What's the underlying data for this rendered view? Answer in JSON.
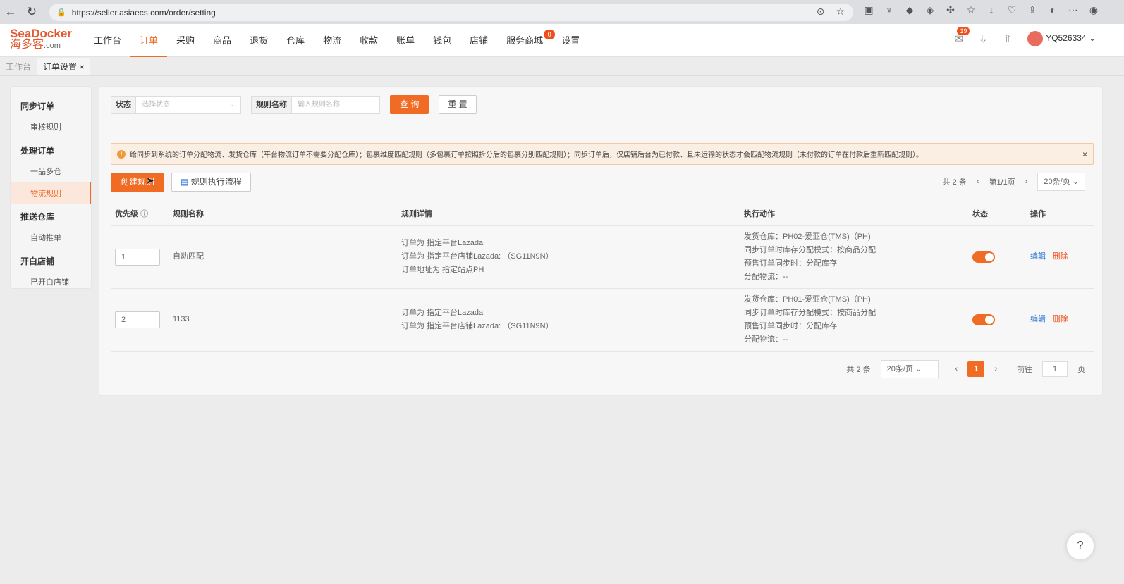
{
  "browser": {
    "url": "https://seller.asiaecs.com/order/setting"
  },
  "logo": {
    "line1": "SeaDocker",
    "line2": "海多客",
    "suffix": ".com"
  },
  "nav": {
    "items": [
      {
        "label": "工作台"
      },
      {
        "label": "订单",
        "active": true
      },
      {
        "label": "采购"
      },
      {
        "label": "商品"
      },
      {
        "label": "退货"
      },
      {
        "label": "仓库"
      },
      {
        "label": "物流"
      },
      {
        "label": "收款"
      },
      {
        "label": "账单"
      },
      {
        "label": "钱包"
      },
      {
        "label": "店铺"
      },
      {
        "label": "服务商城",
        "badge": "0"
      },
      {
        "label": "设置"
      }
    ],
    "notification_count": "19",
    "username": "YQ526334"
  },
  "tabs": [
    {
      "label": "工作台"
    },
    {
      "label": "订单设置",
      "close": "×"
    }
  ],
  "sidebar": {
    "groups": [
      {
        "title": "同步订单",
        "items": [
          "审核规则"
        ]
      },
      {
        "title": "处理订单",
        "items": [
          "一品多仓",
          "物流规则"
        ]
      },
      {
        "title": "推送仓库",
        "items": [
          "自动推单"
        ]
      },
      {
        "title": "开白店铺",
        "items": [
          "已开白店铺"
        ]
      }
    ],
    "active": "物流规则"
  },
  "filter": {
    "status_label": "状态",
    "status_placeholder": "选择状态",
    "name_label": "规则名称",
    "name_placeholder": "输入规则名称",
    "query": "查 询",
    "reset": "重 置"
  },
  "notice": {
    "icon": "!",
    "text": "给同步到系统的订单分配物流、发货仓库（平台物流订单不需要分配仓库）；包裹维度匹配规则（多包裹订单按照拆分后的包裹分别匹配规则）；同步订单后，仅店铺后台为已付款、且未运输的状态才会匹配物流规则（未付款的订单在付款后重新匹配规则）。",
    "close": "×"
  },
  "actions": {
    "create": "创建规则",
    "flow": "规则执行流程"
  },
  "pagination": {
    "total": "共 2 条",
    "pageinfo": "第1/1页",
    "pagesize": "20条/页",
    "current": "1",
    "goto_prefix": "前往",
    "goto_value": "1",
    "goto_suffix": "页"
  },
  "table": {
    "headers": {
      "priority": "优先级",
      "name": "规则名称",
      "detail": "规则详情",
      "action": "执行动作",
      "status": "状态",
      "op": "操作"
    },
    "rows": [
      {
        "priority": "1",
        "name": "自动匹配",
        "details": [
          "订单为 指定平台Lazada",
          "订单为 指定平台店铺Lazada: （SG11N9N）",
          "订单地址为 指定站点PH"
        ],
        "actions": [
          "发货仓库：PH02-爱亚仓(TMS)（PH)",
          "同步订单时库存分配模式：按商品分配",
          "预售订单同步时：分配库存",
          "分配物流：--"
        ],
        "enabled": true,
        "edit": "编辑",
        "delete": "删除"
      },
      {
        "priority": "2",
        "name": "1133",
        "details": [
          "订单为 指定平台Lazada",
          "订单为 指定平台店铺Lazada: （SG11N9N）"
        ],
        "actions": [
          "发货仓库：PH01-爱亚仓(TMS)（PH)",
          "同步订单时库存分配模式：按商品分配",
          "预售订单同步时：分配库存",
          "分配物流：--"
        ],
        "enabled": true,
        "edit": "编辑",
        "delete": "删除"
      }
    ]
  },
  "help": "?",
  "colors": {
    "accent": "#f06b23",
    "link": "#3a7bd5",
    "danger": "#f04e1a"
  }
}
